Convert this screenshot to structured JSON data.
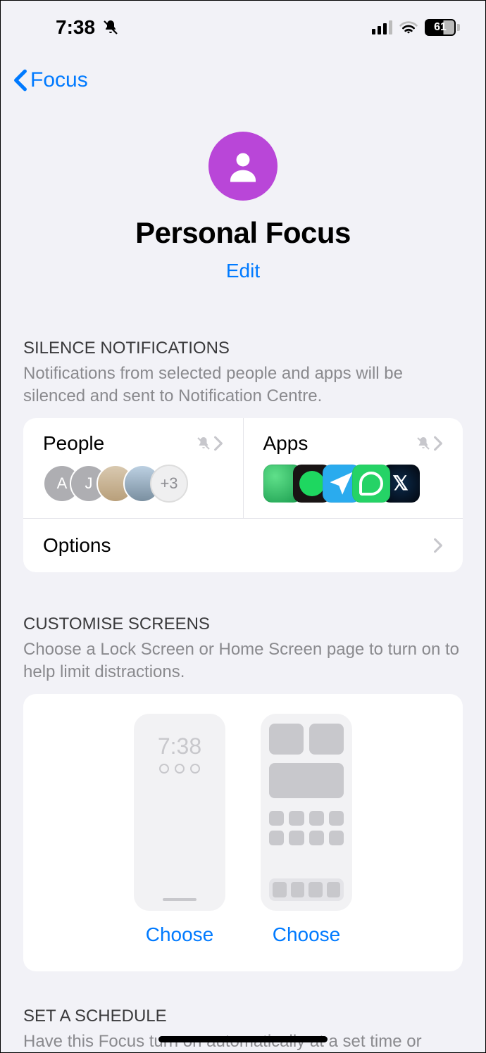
{
  "status_bar": {
    "time": "7:38",
    "battery_percent": "61"
  },
  "nav": {
    "back_label": "Focus"
  },
  "hero": {
    "title": "Personal Focus",
    "edit_label": "Edit"
  },
  "silence_section": {
    "header": "SILENCE NOTIFICATIONS",
    "description": "Notifications from selected people and apps will be silenced and sent to Notification Centre.",
    "people": {
      "title": "People",
      "avatars": [
        "A",
        "J"
      ],
      "overflow": "+3"
    },
    "apps": {
      "title": "Apps",
      "icons": [
        "cricbuzz",
        "spotify",
        "telegram",
        "whatsapp",
        "x"
      ]
    },
    "options_label": "Options"
  },
  "customise_section": {
    "header": "CUSTOMISE SCREENS",
    "description": "Choose a Lock Screen or Home Screen page to turn on to help limit distractions.",
    "lock_time": "7:38",
    "choose_label": "Choose"
  },
  "schedule_section": {
    "header": "SET A SCHEDULE",
    "description": "Have this Focus turn on automatically at a set time or"
  }
}
